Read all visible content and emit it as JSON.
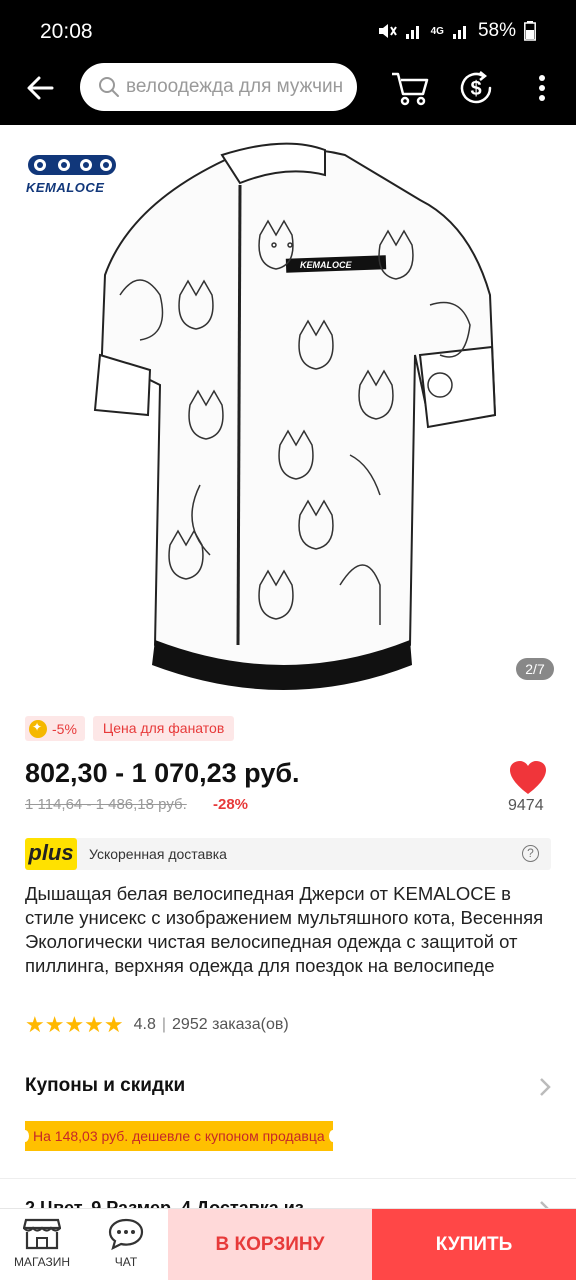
{
  "status_bar": {
    "time": "20:08",
    "battery": "58%",
    "network": "4G"
  },
  "header": {
    "search_placeholder": "велоодежда для мужчин",
    "icons": [
      "back-arrow-icon",
      "search-icon",
      "cart-icon",
      "dollar-refresh-icon",
      "more-vert-icon"
    ]
  },
  "gallery": {
    "counter": "2/7",
    "brand": "KEMALOCE",
    "shirt_label": "KEMALOCE"
  },
  "price_block": {
    "discount_badge": "-5%",
    "fan_badge": "Цена для фанатов",
    "price": "802,30 - 1 070,23 руб.",
    "old_price": "1 114,64 - 1 486,18 руб.",
    "discount_pct": "-28%",
    "wishlist_count": "9474"
  },
  "delivery": {
    "plus_logo": "plus",
    "text": "Ускоренная доставка",
    "help": "?"
  },
  "product": {
    "title": "Дышащая белая велосипедная Джерси от KEMALOCE в стиле унисекс с изображением мультяшного кота, Весенняя Экологически чистая велосипедная одежда с защитой от пиллинга, верхняя одежда для поездок на велосипеде",
    "stars": "★★★★★",
    "rating": "4.8",
    "orders": "2952 заказа(ов)"
  },
  "coupons": {
    "title": "Купоны и скидки",
    "tag": "На 148,03 руб. дешевле с купоном продавца"
  },
  "next_section": {
    "partial_text": "2 Цвет, 9 Размер, 4 Доставка из"
  },
  "bottom_bar": {
    "store_label": "МАГАЗИН",
    "chat_label": "ЧАТ",
    "cart_button": "В КОРЗИНУ",
    "buy_button": "КУПИТЬ"
  },
  "colors": {
    "accent": "#ff4747",
    "cart_bg": "#ffd9d9",
    "coupon": "#ffc000",
    "plus": "#ffe100"
  }
}
